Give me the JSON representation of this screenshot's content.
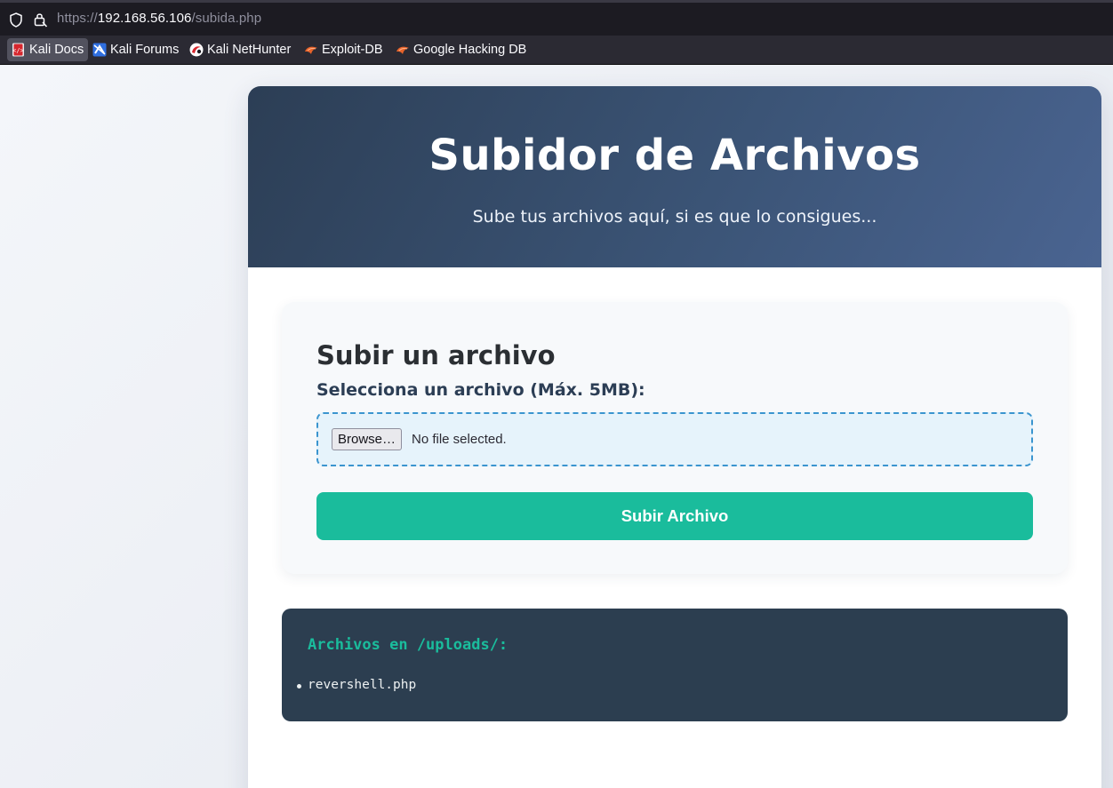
{
  "browser": {
    "url_scheme": "https://",
    "url_host": "192.168.56.106",
    "url_path": "/subida.php",
    "bookmarks": [
      {
        "label": "Kali Docs",
        "icon": "kali-docs-icon",
        "active": true
      },
      {
        "label": "Kali Forums",
        "icon": "kali-forums-icon",
        "active": false
      },
      {
        "label": "Kali NetHunter",
        "icon": "kali-nethunter-icon",
        "active": false
      },
      {
        "label": "Exploit-DB",
        "icon": "exploit-db-icon",
        "active": false
      },
      {
        "label": "Google Hacking DB",
        "icon": "google-hacking-db-icon",
        "active": false
      }
    ]
  },
  "header": {
    "title": "Subidor de Archivos",
    "subtitle": "Sube tus archivos aquí, si es que lo consigues..."
  },
  "upload_form": {
    "heading": "Subir un archivo",
    "label": "Selecciona un archivo (Máx. 5MB):",
    "browse_label": "Browse…",
    "file_status": "No file selected.",
    "submit_label": "Subir Archivo"
  },
  "file_list": {
    "heading": "Archivos en /uploads/:",
    "items": [
      "revershell.php"
    ]
  },
  "colors": {
    "accent": "#1abc9c",
    "header_start": "#2c3e55",
    "header_end": "#4a6491",
    "file_panel": "#2c3e50",
    "dropzone_border": "#3b95cf"
  }
}
